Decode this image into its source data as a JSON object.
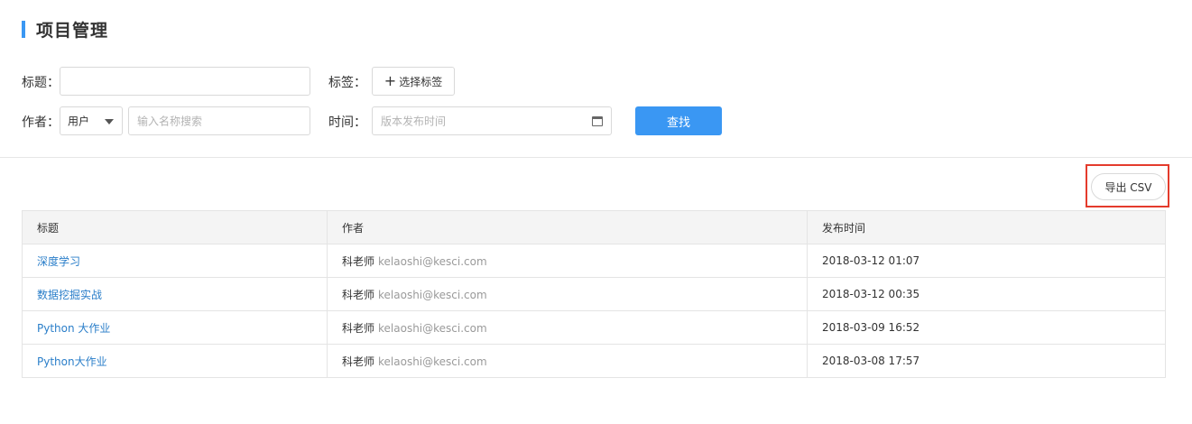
{
  "page": {
    "title": "项目管理"
  },
  "filters": {
    "title_label": "标题：",
    "title_value": "",
    "tags_label": "标签：",
    "tags_button": "选择标签",
    "tags_plus": "+",
    "author_label": "作者：",
    "author_select_value": "用户",
    "author_placeholder": "输入名称搜索",
    "time_label": "时间：",
    "time_placeholder": "版本发布时间",
    "search_button": "查找"
  },
  "toolbar": {
    "export_label": "导出 CSV"
  },
  "table": {
    "columns": [
      "标题",
      "作者",
      "发布时间"
    ],
    "rows": [
      {
        "title": "深度学习",
        "author": "科老师",
        "email": "kelaoshi@kesci.com",
        "time": "2018-03-12 01:07"
      },
      {
        "title": "数据挖掘实战",
        "author": "科老师",
        "email": "kelaoshi@kesci.com",
        "time": "2018-03-12 00:35"
      },
      {
        "title": "Python 大作业",
        "author": "科老师",
        "email": "kelaoshi@kesci.com",
        "time": "2018-03-09 16:52"
      },
      {
        "title": "Python大作业",
        "author": "科老师",
        "email": "kelaoshi@kesci.com",
        "time": "2018-03-08 17:57"
      }
    ]
  },
  "colors": {
    "accent": "#3a97f3",
    "link": "#2a7ec9",
    "highlight": "#e43b2c"
  }
}
